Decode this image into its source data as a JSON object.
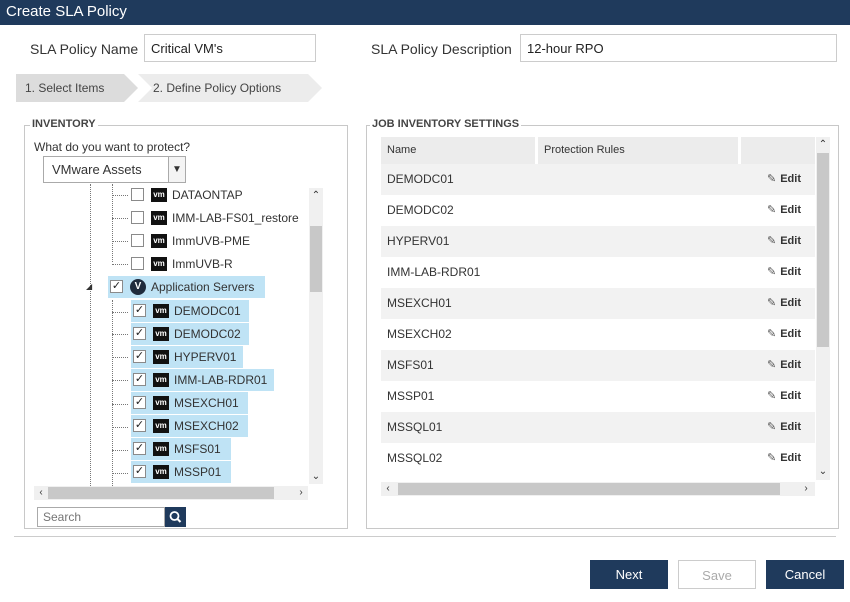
{
  "window": {
    "title": "Create SLA Policy"
  },
  "policy": {
    "name_label": "SLA Policy Name",
    "name_value": "Critical VM's",
    "desc_label": "SLA Policy Description",
    "desc_value": "12-hour RPO"
  },
  "wizard": {
    "steps": [
      "1. Select Items",
      "2. Define Policy Options"
    ]
  },
  "inventory": {
    "legend": "INVENTORY",
    "question": "What do you want to protect?",
    "selected_type": "VMware Assets",
    "tree": [
      {
        "label": "DATAONTAP",
        "checked": false,
        "icon": "vm-icon"
      },
      {
        "label": "IMM-LAB-FS01_restore",
        "checked": false,
        "icon": "vm-icon"
      },
      {
        "label": "ImmUVB-PME",
        "checked": false,
        "icon": "vm-icon"
      },
      {
        "label": "ImmUVB-R",
        "checked": false,
        "icon": "vm-icon"
      },
      {
        "label": "Application Servers",
        "checked": true,
        "icon": "vapp-icon"
      },
      {
        "label": "DEMODC01",
        "checked": true,
        "icon": "vm-icon"
      },
      {
        "label": "DEMODC02",
        "checked": true,
        "icon": "vm-icon"
      },
      {
        "label": "HYPERV01",
        "checked": true,
        "icon": "vm-icon"
      },
      {
        "label": "IMM-LAB-RDR01",
        "checked": true,
        "icon": "vm-icon"
      },
      {
        "label": "MSEXCH01",
        "checked": true,
        "icon": "vm-icon"
      },
      {
        "label": "MSEXCH02",
        "checked": true,
        "icon": "vm-icon"
      },
      {
        "label": "MSFS01",
        "checked": true,
        "icon": "vm-icon"
      },
      {
        "label": "MSSP01",
        "checked": true,
        "icon": "vm-icon"
      }
    ],
    "search_placeholder": "Search"
  },
  "job": {
    "legend": "JOB INVENTORY SETTINGS",
    "columns": [
      "Name",
      "Protection Rules",
      ""
    ],
    "edit_label": "Edit",
    "rows": [
      "DEMODC01",
      "DEMODC02",
      "HYPERV01",
      "IMM-LAB-RDR01",
      "MSEXCH01",
      "MSEXCH02",
      "MSFS01",
      "MSSP01",
      "MSSQL01",
      "MSSQL02"
    ]
  },
  "footer": {
    "next": "Next",
    "save": "Save",
    "cancel": "Cancel"
  },
  "colors": {
    "primary": "#1f3a5c",
    "selection": "#bfe3f5"
  }
}
